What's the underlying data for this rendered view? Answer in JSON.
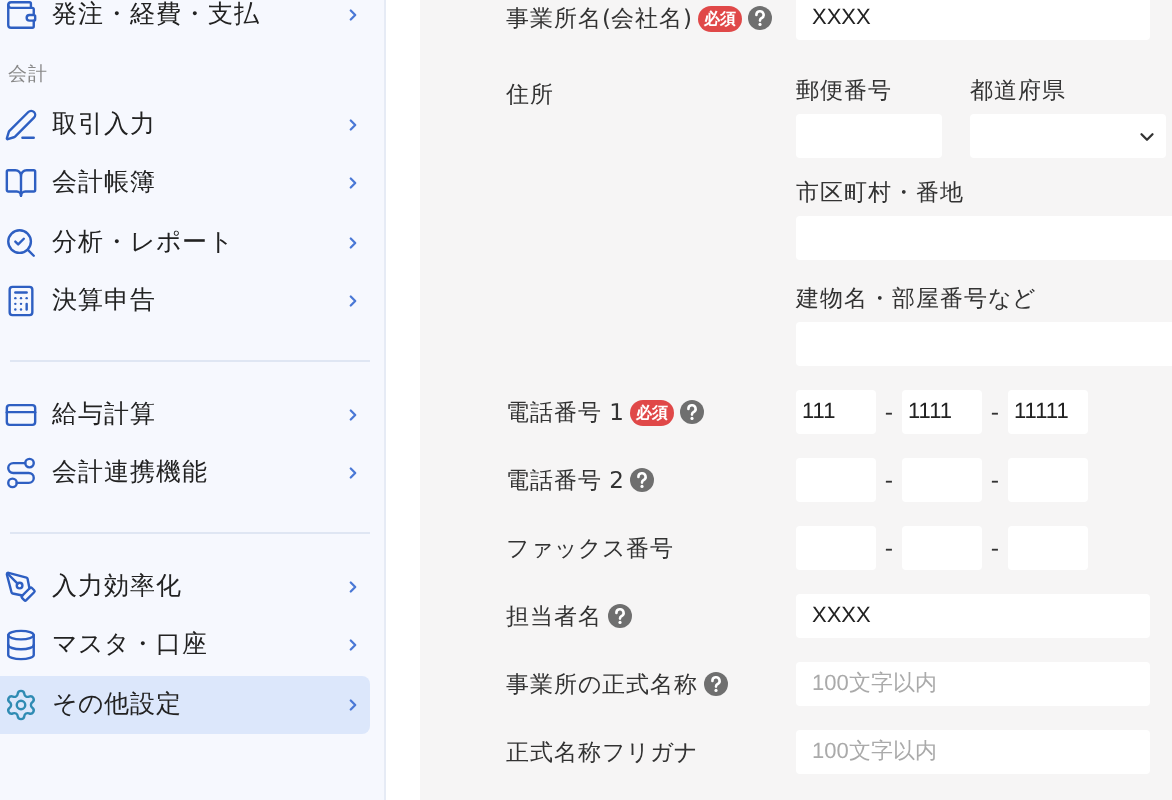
{
  "sidebar": {
    "sections": [
      {
        "items": [
          {
            "label": "発注・経費・支払",
            "selected": false
          }
        ]
      },
      {
        "heading": "会計",
        "items": [
          {
            "label": "取引入力",
            "selected": false
          },
          {
            "label": "会計帳簿",
            "selected": false
          },
          {
            "label": "分析・レポート",
            "selected": false
          },
          {
            "label": "決算申告",
            "selected": false
          }
        ]
      },
      {
        "items": [
          {
            "label": "給与計算",
            "selected": false
          },
          {
            "label": "会計連携機能",
            "selected": false
          }
        ]
      },
      {
        "items": [
          {
            "label": "入力効率化",
            "selected": false
          },
          {
            "label": "マスタ・口座",
            "selected": false
          },
          {
            "label": "その他設定",
            "selected": true
          }
        ]
      }
    ]
  },
  "form": {
    "rows": [
      {
        "kind": "text",
        "label": "事業所名(会社名)",
        "required": "必須",
        "help": true,
        "value": "XXXX"
      },
      {
        "kind": "address",
        "label": "住所",
        "postal": "郵便番号",
        "prefecture": "都道府県",
        "city": "市区町村・番地",
        "building": "建物名・部屋番号など"
      },
      {
        "kind": "phone",
        "label": "電話番号 1",
        "required": "必須",
        "help": true,
        "separator": "-",
        "values": [
          "111",
          "1111",
          "11111"
        ]
      },
      {
        "kind": "phone",
        "label": "電話番号 2",
        "help": true,
        "separator": "-"
      },
      {
        "kind": "phone",
        "label": "ファックス番号",
        "help": false,
        "separator": "-"
      },
      {
        "kind": "text",
        "label": "担当者名",
        "help": true,
        "value": "XXXX"
      },
      {
        "kind": "text",
        "label": "事業所の正式名称",
        "help": true,
        "placeholder": "100文字以内"
      },
      {
        "kind": "text",
        "label": "正式名称フリガナ",
        "help": false,
        "placeholder": "100文字以内"
      }
    ]
  }
}
